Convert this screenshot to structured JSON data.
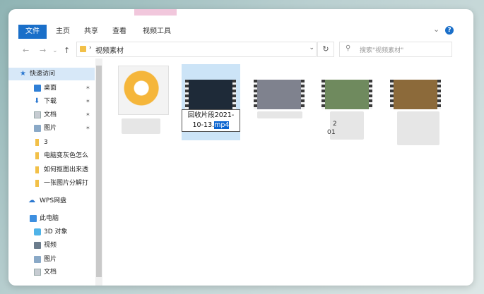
{
  "ribbon": {
    "tabs": [
      "文件",
      "主页",
      "共享",
      "查看",
      "视频工具"
    ]
  },
  "address": {
    "path": "视频素材",
    "search_placeholder": "搜索\"视频素材\""
  },
  "sidebar": {
    "items": [
      {
        "label": "快速访问",
        "icon": "star-icon"
      },
      {
        "label": "桌面",
        "icon": "desktop-icon",
        "pinned": true
      },
      {
        "label": "下载",
        "icon": "download-icon",
        "pinned": true
      },
      {
        "label": "文档",
        "icon": "document-icon",
        "pinned": true
      },
      {
        "label": "图片",
        "icon": "picture-icon",
        "pinned": true
      },
      {
        "label": "3",
        "icon": "folder-icon"
      },
      {
        "label": "电脑变灰色怎么",
        "icon": "folder-icon"
      },
      {
        "label": "如何抠图出来透",
        "icon": "folder-icon"
      },
      {
        "label": "一张图片分解打",
        "icon": "folder-icon"
      },
      {
        "label": "WPS网盘",
        "icon": "cloud-icon"
      },
      {
        "label": "此电脑",
        "icon": "computer-icon"
      },
      {
        "label": "3D 对象",
        "icon": "3d-objects-icon"
      },
      {
        "label": "视频",
        "icon": "video-folder-icon"
      },
      {
        "label": "图片",
        "icon": "picture-icon"
      },
      {
        "label": "文档",
        "icon": "document-icon"
      }
    ]
  },
  "content": {
    "rename_base": "回收片段2021-10-13.",
    "rename_selected_ext": "mp4",
    "partial_label_1": "2",
    "partial_label_2": "0",
    "partial_label_3": "1"
  }
}
